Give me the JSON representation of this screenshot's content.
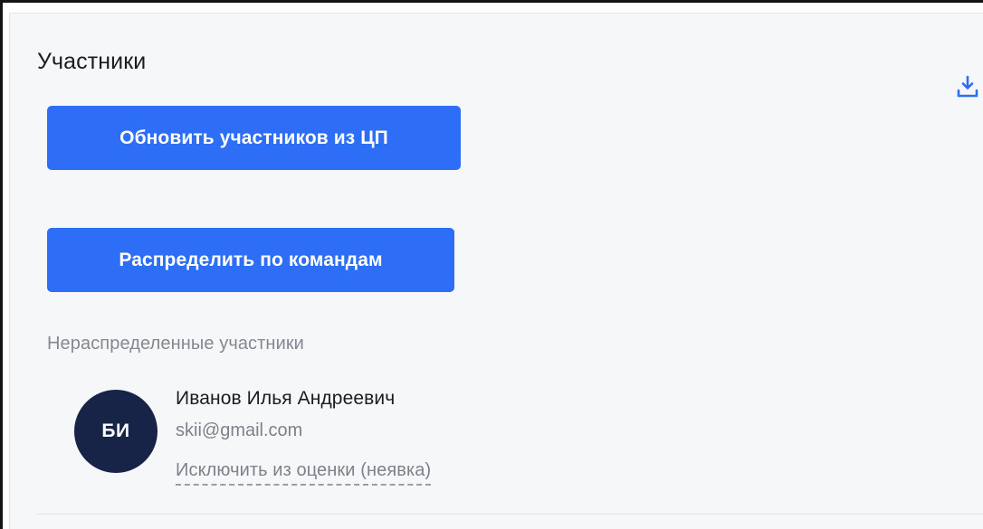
{
  "section": {
    "title": "Участники",
    "download_icon": "download-icon"
  },
  "buttons": {
    "refresh_label": "Обновить участников из ЦП",
    "distribute_label": "Распределить по командам"
  },
  "unassigned": {
    "label": "Нераспределенные участники",
    "members": [
      {
        "initials": "БИ",
        "name": "Иванов Илья Андреевич",
        "email": "skii@gmail.com",
        "action": "Исключить из оценки (неявка)"
      }
    ]
  },
  "colors": {
    "accent": "#2e6ef7",
    "avatar_bg": "#182447",
    "panel_bg": "#f6f7f9"
  }
}
